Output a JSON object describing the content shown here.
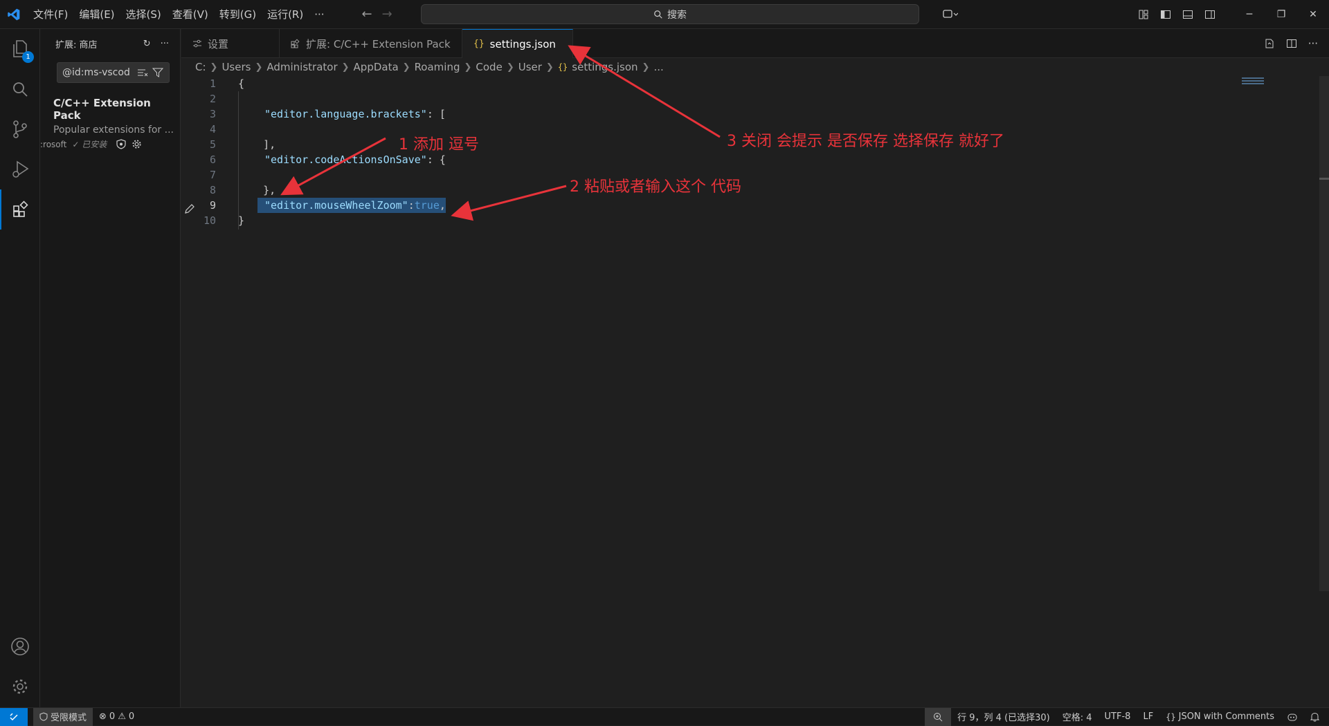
{
  "menu": [
    "文件(F)",
    "编辑(E)",
    "选择(S)",
    "查看(V)",
    "转到(G)",
    "运行(R)",
    "···"
  ],
  "search": {
    "placeholder": "搜索"
  },
  "activity": {
    "explorer_badge": "1"
  },
  "sidebar": {
    "title": "扩展: 商店",
    "search_value": "@id:ms-vscod",
    "extension": {
      "name": "C/C++ Extension Pack",
      "description": "Popular extensions for ...",
      "publisher": ":rosoft",
      "installed": "✓ 已安装"
    }
  },
  "tabs": [
    {
      "label": "设置",
      "icon": "settings-icon"
    },
    {
      "label": "扩展: C/C++ Extension Pack",
      "icon": "extensions-icon"
    },
    {
      "label": "settings.json",
      "icon": "json-braces-icon",
      "modified": true
    }
  ],
  "breadcrumb": [
    "C:",
    "Users",
    "Administrator",
    "AppData",
    "Roaming",
    "Code",
    "User",
    "settings.json",
    "..."
  ],
  "editor": {
    "current_line": 9,
    "lines": [
      {
        "n": "1",
        "text": "{"
      },
      {
        "n": "2",
        "text": ""
      },
      {
        "n": "3",
        "key": "\"editor.language.brackets\"",
        "rest": ": ["
      },
      {
        "n": "4",
        "text": ""
      },
      {
        "n": "5",
        "text": "    ],"
      },
      {
        "n": "6",
        "key": "\"editor.codeActionsOnSave\"",
        "rest": ": {"
      },
      {
        "n": "7",
        "text": ""
      },
      {
        "n": "8",
        "text": "    },"
      },
      {
        "n": "9",
        "key": "\"editor.mouseWheelZoom\"",
        "colon": ":",
        "value": "true",
        "comma": ","
      },
      {
        "n": "10",
        "text": "}"
      }
    ]
  },
  "annotations": {
    "a1": "1 添加  逗号",
    "a2": "2  粘贴或者输入这个 代码",
    "a3": "3 关闭 会提示 是否保存 选择保存 就好了"
  },
  "status": {
    "restricted": "受限模式",
    "errors": "0",
    "warnings": "0",
    "position": "行 9，列 4 (已选择30)",
    "spaces": "空格: 4",
    "encoding": "UTF-8",
    "eol": "LF",
    "language": "JSON with Comments"
  },
  "colors": {
    "accent": "#0078d4",
    "annotation": "#e8333a",
    "selection": "#264f78"
  }
}
